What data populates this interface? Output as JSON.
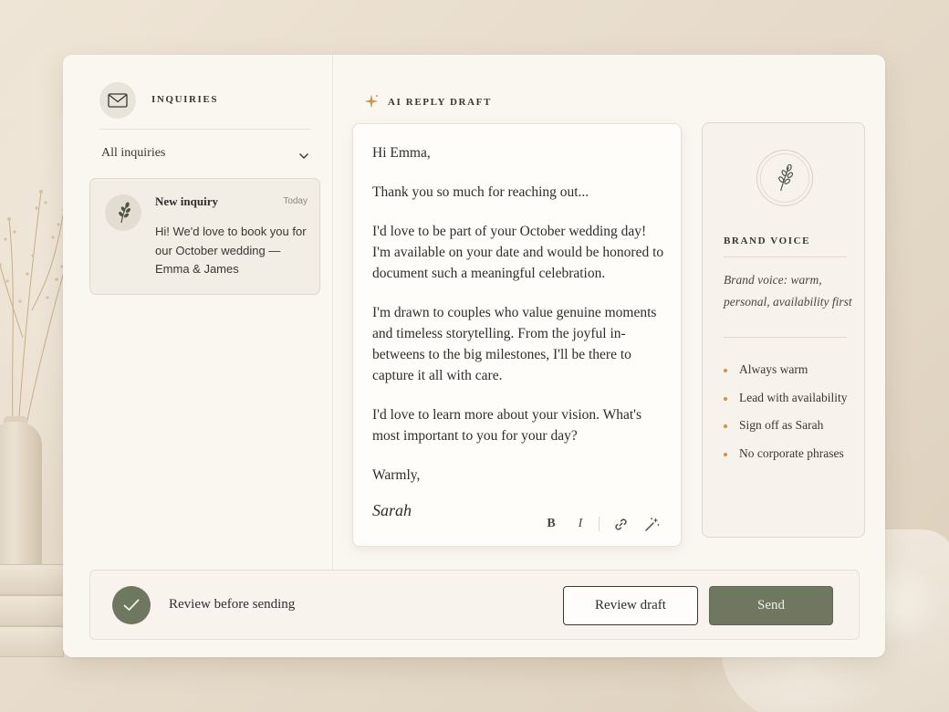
{
  "sidebar": {
    "title": "INQUIRIES",
    "filter": "All inquiries",
    "inquiry": {
      "title": "New inquiry",
      "time": "Today",
      "preview": "Hi! We'd love to book you for our October wedding — Emma & James"
    }
  },
  "draft": {
    "label": "AI REPLY DRAFT",
    "greeting": "Hi Emma,",
    "p1": "Thank you so much for reaching out...",
    "p2": "I'd love to be part of your October wedding day! I'm available on your date and would be honored to document such a meaningful celebration.",
    "p3": "I'm drawn to couples who value genuine moments and timeless storytelling. From the joyful in-betweens to the big milestones, I'll be there to capture it all with care.",
    "p4": "I'd love to learn more about your vision. What's most important to you for your day?",
    "closing": "Warmly,",
    "signature": "Sarah",
    "toolbar": {
      "bold": "B",
      "italic": "I"
    }
  },
  "voice": {
    "title": "BRAND VOICE",
    "description": "Brand voice: warm, personal, availability first",
    "rules": [
      "Always warm",
      "Lead with availability",
      "Sign off as Sarah",
      "No corporate phrases"
    ]
  },
  "footer": {
    "status": "Review before sending",
    "review_label": "Review draft",
    "send_label": "Send"
  },
  "colors": {
    "accent_green": "#6f7760",
    "bullet_gold": "#c9954b",
    "sparkle_gold": "#c9954b"
  }
}
